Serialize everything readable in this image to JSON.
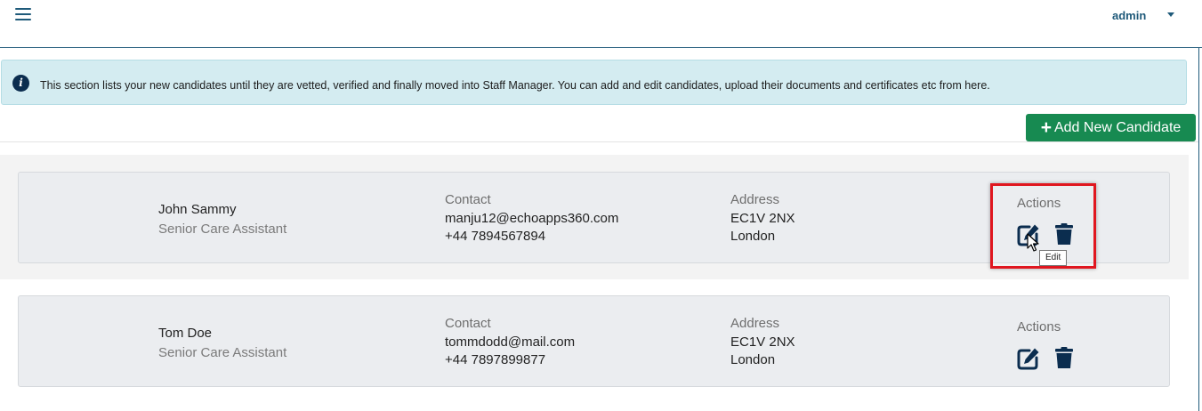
{
  "header": {
    "menu_icon": "hamburger-icon",
    "user_label": "admin",
    "user_caret_icon": "caret-down-icon"
  },
  "info": {
    "icon": "info-icon",
    "icon_glyph": "i",
    "text": "This section lists your new candidates until they are vetted, verified and finally moved into Staff Manager. You can add and edit candidates, upload their documents and certificates etc from here."
  },
  "toolbar": {
    "add_label": "Add New Candidate",
    "add_icon": "plus-icon",
    "add_color": "#178a51"
  },
  "labels": {
    "contact": "Contact",
    "address": "Address",
    "actions": "Actions"
  },
  "candidates": [
    {
      "name": "John Sammy",
      "role": "Senior Care Assistant",
      "email": "manju12@echoapps360.com",
      "phone": "+44 7894567894",
      "postcode": "EC1V 2NX",
      "city": "London"
    },
    {
      "name": "Tom Doe",
      "role": "Senior Care Assistant",
      "email": "tommdodd@mail.com",
      "phone": "+44 7897899877",
      "postcode": "EC1V 2NX",
      "city": "London"
    }
  ],
  "tooltip": {
    "text": "Edit"
  },
  "colors": {
    "brand_dark": "#0b2d4f",
    "highlight": "#e0161f",
    "banner_bg": "#d4ecf1"
  }
}
